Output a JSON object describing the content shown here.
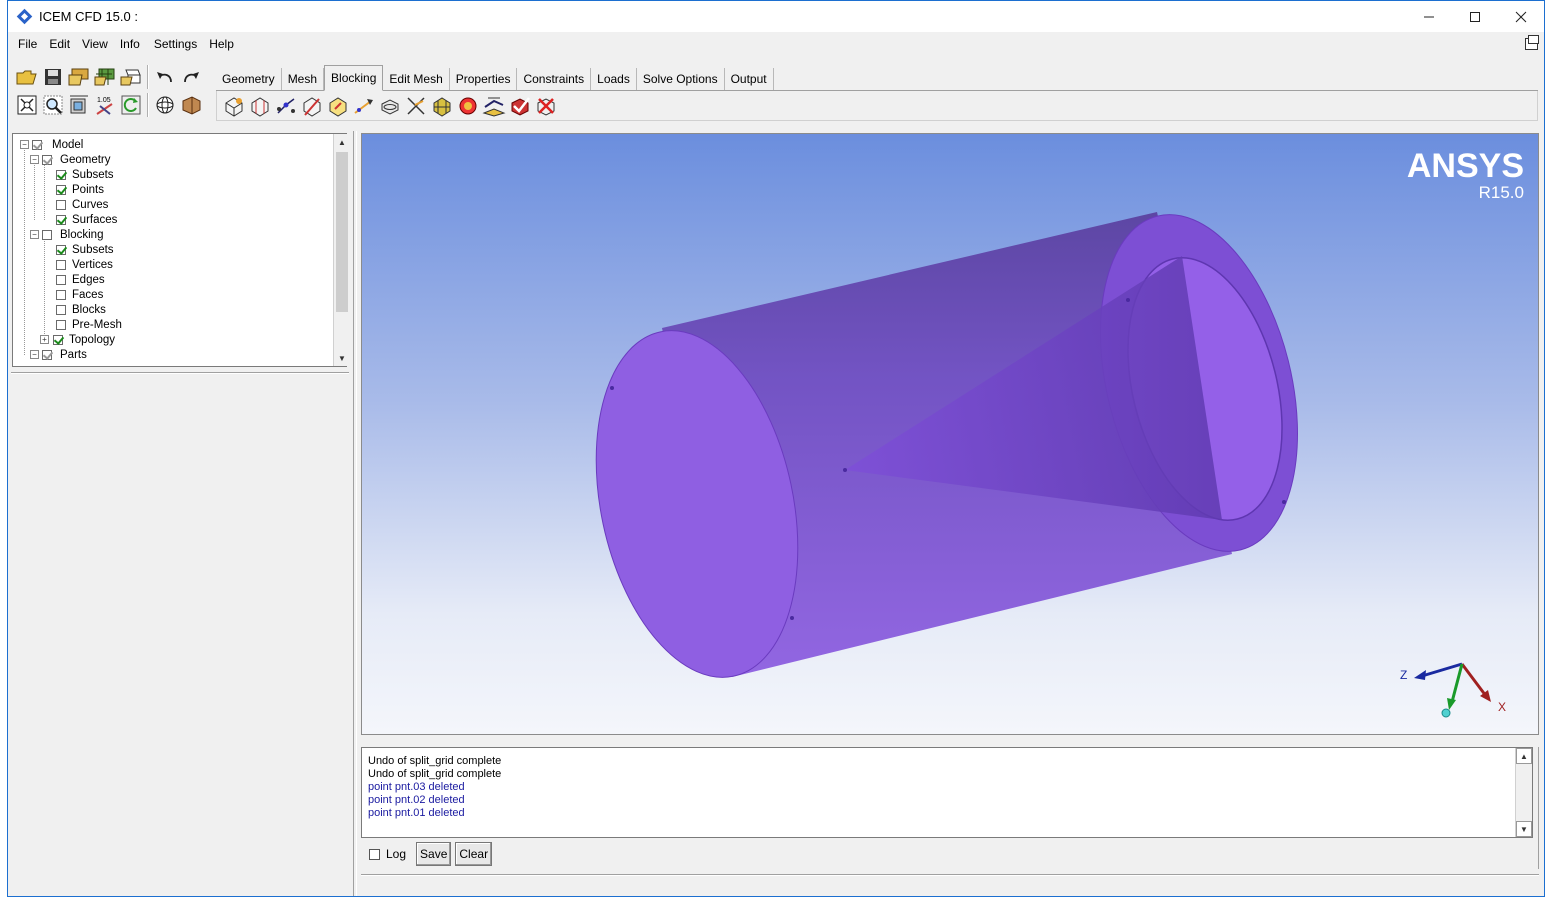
{
  "window": {
    "title": "ICEM CFD 15.0 :"
  },
  "menu": [
    "File",
    "Edit",
    "View",
    "Info",
    "Settings",
    "Help"
  ],
  "tabs": [
    "Geometry",
    "Mesh",
    "Blocking",
    "Edit Mesh",
    "Properties",
    "Constraints",
    "Loads",
    "Solve Options",
    "Output"
  ],
  "active_tab": "Blocking",
  "tree": {
    "model": "Model",
    "geometry": "Geometry",
    "geometry_children": [
      {
        "label": "Subsets",
        "checked": true
      },
      {
        "label": "Points",
        "checked": true
      },
      {
        "label": "Curves",
        "checked": false
      },
      {
        "label": "Surfaces",
        "checked": true
      }
    ],
    "blocking": "Blocking",
    "blocking_children": [
      {
        "label": "Subsets",
        "checked": true
      },
      {
        "label": "Vertices",
        "checked": false
      },
      {
        "label": "Edges",
        "checked": false
      },
      {
        "label": "Faces",
        "checked": false
      },
      {
        "label": "Blocks",
        "checked": false
      },
      {
        "label": "Pre-Mesh",
        "checked": false
      },
      {
        "label": "Topology",
        "checked": true
      }
    ],
    "parts": "Parts"
  },
  "viewport": {
    "logo": "ANSYS",
    "version": "R15.0",
    "axis_labels": {
      "z": "Z",
      "x": "X"
    },
    "colors": {
      "solid": "#8a5ae0",
      "edge": "#6a3bbf"
    }
  },
  "messages": [
    {
      "text": "Undo of split_grid complete",
      "color": "#000000"
    },
    {
      "text": "Undo of split_grid complete",
      "color": "#000000"
    },
    {
      "text": "point pnt.03 deleted",
      "color": "#1a1aa0"
    },
    {
      "text": "point pnt.02 deleted",
      "color": "#1a1aa0"
    },
    {
      "text": "point pnt.01 deleted",
      "color": "#1a1aa0"
    }
  ],
  "message_controls": {
    "log_label": "Log",
    "save_label": "Save",
    "clear_label": "Clear"
  }
}
